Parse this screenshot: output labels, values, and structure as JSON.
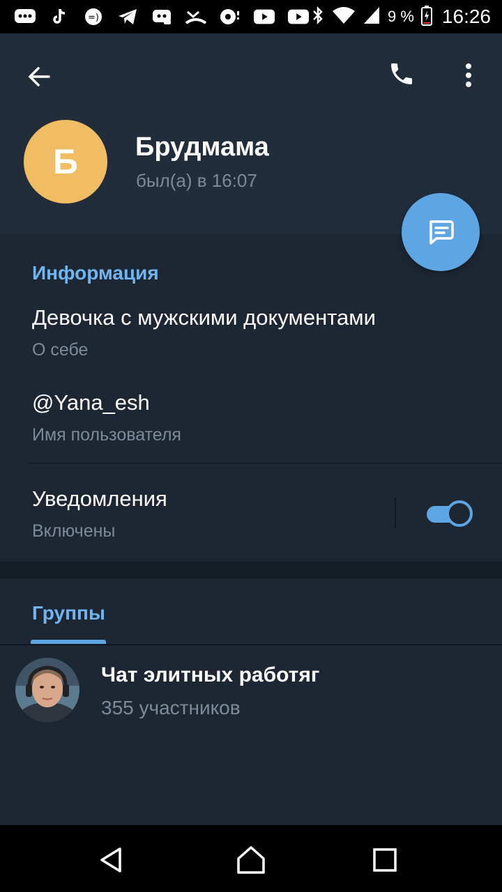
{
  "status_bar": {
    "icons": [
      "chat-bubble-icon",
      "tiktok-icon",
      "chat-face-icon",
      "telegram-icon",
      "discord-icon",
      "missed-call-icon",
      "media-icon",
      "youtube-icon",
      "youtube-icon",
      "bluetooth-icon",
      "wifi-icon",
      "signal-icon"
    ],
    "battery": "9 %",
    "time": "16:26"
  },
  "header": {
    "avatar_letter": "Б",
    "name": "Брудмама",
    "last_seen": "был(а) в 16:07",
    "avatar_color": "#f1bd63"
  },
  "info": {
    "section_title": "Информация",
    "bio": "Девочка с мужскими документами",
    "bio_label": "О себе",
    "username": "@Yana_esh",
    "username_label": "Имя пользователя",
    "notifications": "Уведомления",
    "notifications_state": "Включены",
    "notifications_on": true
  },
  "groups": {
    "tab_label": "Группы",
    "items": [
      {
        "name": "Чат элитных работяг",
        "members": "355 участников"
      }
    ]
  },
  "colors": {
    "accent": "#5ea6e3",
    "link": "#70b4f0",
    "background": "#1d2733",
    "header_bg": "#212d3b"
  }
}
